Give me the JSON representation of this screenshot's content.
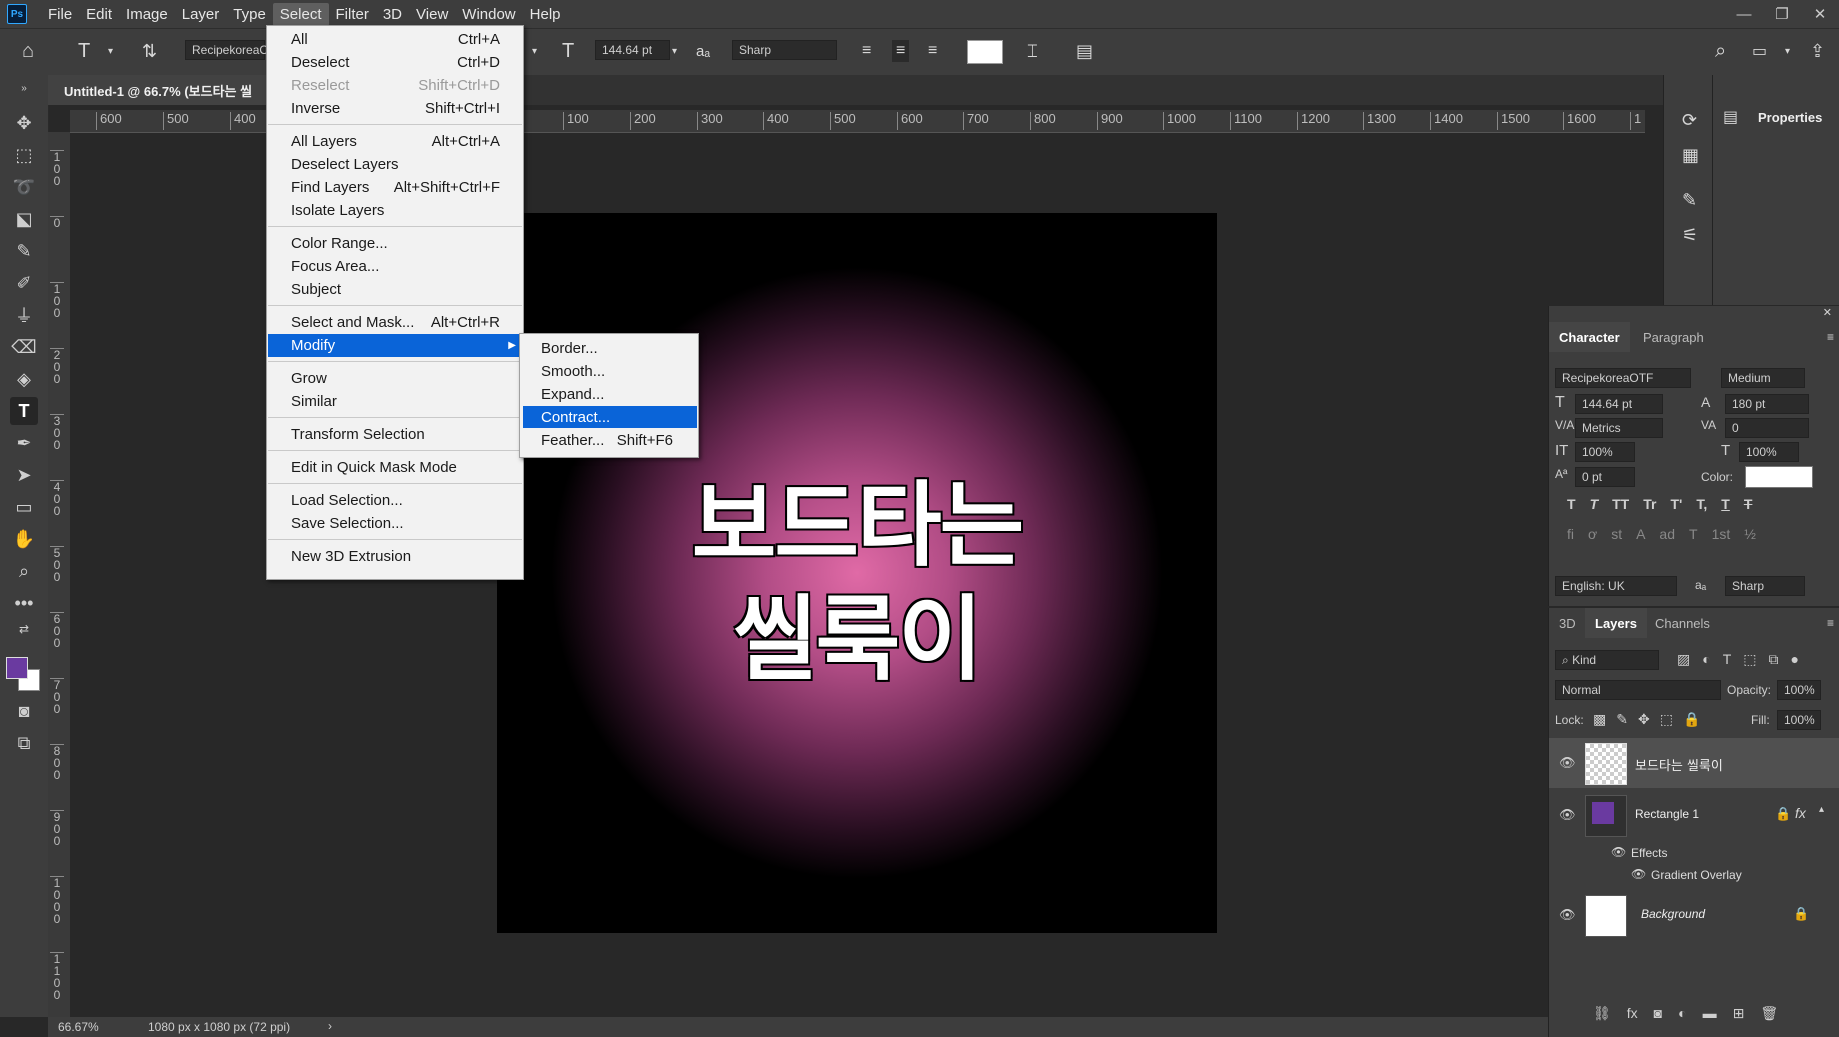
{
  "menubar": {
    "logo": "Ps",
    "items": [
      "File",
      "Edit",
      "Image",
      "Layer",
      "Type",
      "Select",
      "Filter",
      "3D",
      "View",
      "Window",
      "Help"
    ],
    "active": "Select",
    "window_controls": [
      "—",
      "❐",
      "✕"
    ]
  },
  "options": {
    "font_family": "RecipekoreaO",
    "font_size": "144.64 pt",
    "aa_label": "aₐ",
    "antialias": "Sharp"
  },
  "document": {
    "tab_title": "Untitled-1 @ 66.7% (보드타는 씰",
    "zoom": "66.67%",
    "info": "1080 px x 1080 px (72 ppi)",
    "canvas_line1": "보드타는",
    "canvas_line2": "씰룩이"
  },
  "ruler_top": [
    "600",
    "500",
    "400",
    "100",
    "200",
    "300",
    "400",
    "500",
    "600",
    "700",
    "800",
    "900",
    "1000",
    "1100",
    "1200",
    "1300",
    "1400",
    "1500",
    "1600",
    "1"
  ],
  "ruler_left": [
    "1\n0\n0",
    "0",
    "1\n0\n0",
    "2\n0\n0",
    "3\n0\n0",
    "4\n0\n0",
    "5\n0\n0",
    "6\n0\n0",
    "7\n0\n0",
    "8\n0\n0",
    "9\n0\n0",
    "1\n0\n0\n0",
    "1\n1\n0\n0"
  ],
  "select_menu": {
    "items": [
      {
        "label": "All",
        "shortcut": "Ctrl+A"
      },
      {
        "label": "Deselect",
        "shortcut": "Ctrl+D"
      },
      {
        "label": "Reselect",
        "shortcut": "Shift+Ctrl+D"
      },
      {
        "label": "Inverse",
        "shortcut": "Shift+Ctrl+I"
      },
      {
        "label": "All Layers",
        "shortcut": "Alt+Ctrl+A"
      },
      {
        "label": "Deselect Layers",
        "shortcut": ""
      },
      {
        "label": "Find Layers",
        "shortcut": "Alt+Shift+Ctrl+F"
      },
      {
        "label": "Isolate Layers",
        "shortcut": ""
      },
      {
        "label": "Color Range...",
        "shortcut": ""
      },
      {
        "label": "Focus Area...",
        "shortcut": ""
      },
      {
        "label": "Subject",
        "shortcut": ""
      },
      {
        "label": "Select and Mask...",
        "shortcut": "Alt+Ctrl+R"
      },
      {
        "label": "Modify",
        "shortcut": "▶"
      },
      {
        "label": "Grow",
        "shortcut": ""
      },
      {
        "label": "Similar",
        "shortcut": ""
      },
      {
        "label": "Transform Selection",
        "shortcut": ""
      },
      {
        "label": "Edit in Quick Mask Mode",
        "shortcut": ""
      },
      {
        "label": "Load Selection...",
        "shortcut": ""
      },
      {
        "label": "Save Selection...",
        "shortcut": ""
      },
      {
        "label": "New 3D Extrusion",
        "shortcut": ""
      }
    ]
  },
  "modify_submenu": {
    "items": [
      {
        "label": "Border...",
        "shortcut": ""
      },
      {
        "label": "Smooth...",
        "shortcut": ""
      },
      {
        "label": "Expand...",
        "shortcut": ""
      },
      {
        "label": "Contract...",
        "shortcut": ""
      },
      {
        "label": "Feather...",
        "shortcut": "Shift+F6"
      }
    ]
  },
  "properties": {
    "label": "Properties"
  },
  "character": {
    "tabs": [
      "Character",
      "Paragraph"
    ],
    "font": "RecipekoreaOTF",
    "style": "Medium",
    "size": "144.64 pt",
    "leading": "180 pt",
    "kerning": "Metrics",
    "tracking": "0",
    "vscale": "100%",
    "hscale": "100%",
    "baseline": "0 pt",
    "color_label": "Color:",
    "language": "English: UK",
    "aa_label": "aₐ",
    "antialias": "Sharp",
    "style_buttons": [
      "T",
      "T",
      "TT",
      "Tr",
      "T'",
      "T,",
      "T",
      "T"
    ],
    "ot_buttons": [
      "fi",
      "ơ",
      "st",
      "A",
      "ad",
      "T",
      "1st",
      "½"
    ]
  },
  "layers": {
    "tabs": [
      "3D",
      "Layers",
      "Channels"
    ],
    "filter": "Kind",
    "blend": "Normal",
    "opacity_label": "Opacity:",
    "opacity": "100%",
    "lock_label": "Lock:",
    "fill_label": "Fill:",
    "fill": "100%",
    "list": [
      {
        "name": "보드타는 씰룩이"
      },
      {
        "name": "Rectangle 1",
        "effects": "Effects",
        "effect": "Gradient Overlay",
        "fx": "fx"
      },
      {
        "name": "Background"
      }
    ]
  },
  "colors": {
    "foreground": "#6a3aa0",
    "background": "#ffffff",
    "highlight": "#0a64d8"
  }
}
